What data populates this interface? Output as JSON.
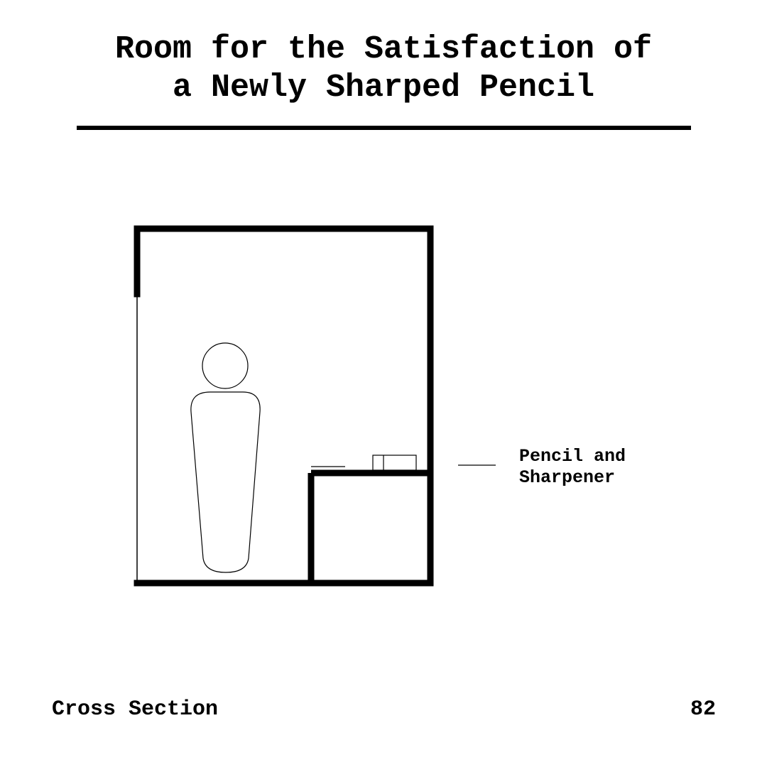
{
  "title": {
    "line1": "Room for the Satisfaction of",
    "line2": "a Newly Sharped Pencil"
  },
  "callout": {
    "line1": "Pencil and",
    "line2": "Sharpener"
  },
  "footer": {
    "view_label": "Cross Section",
    "page_number": "82"
  }
}
